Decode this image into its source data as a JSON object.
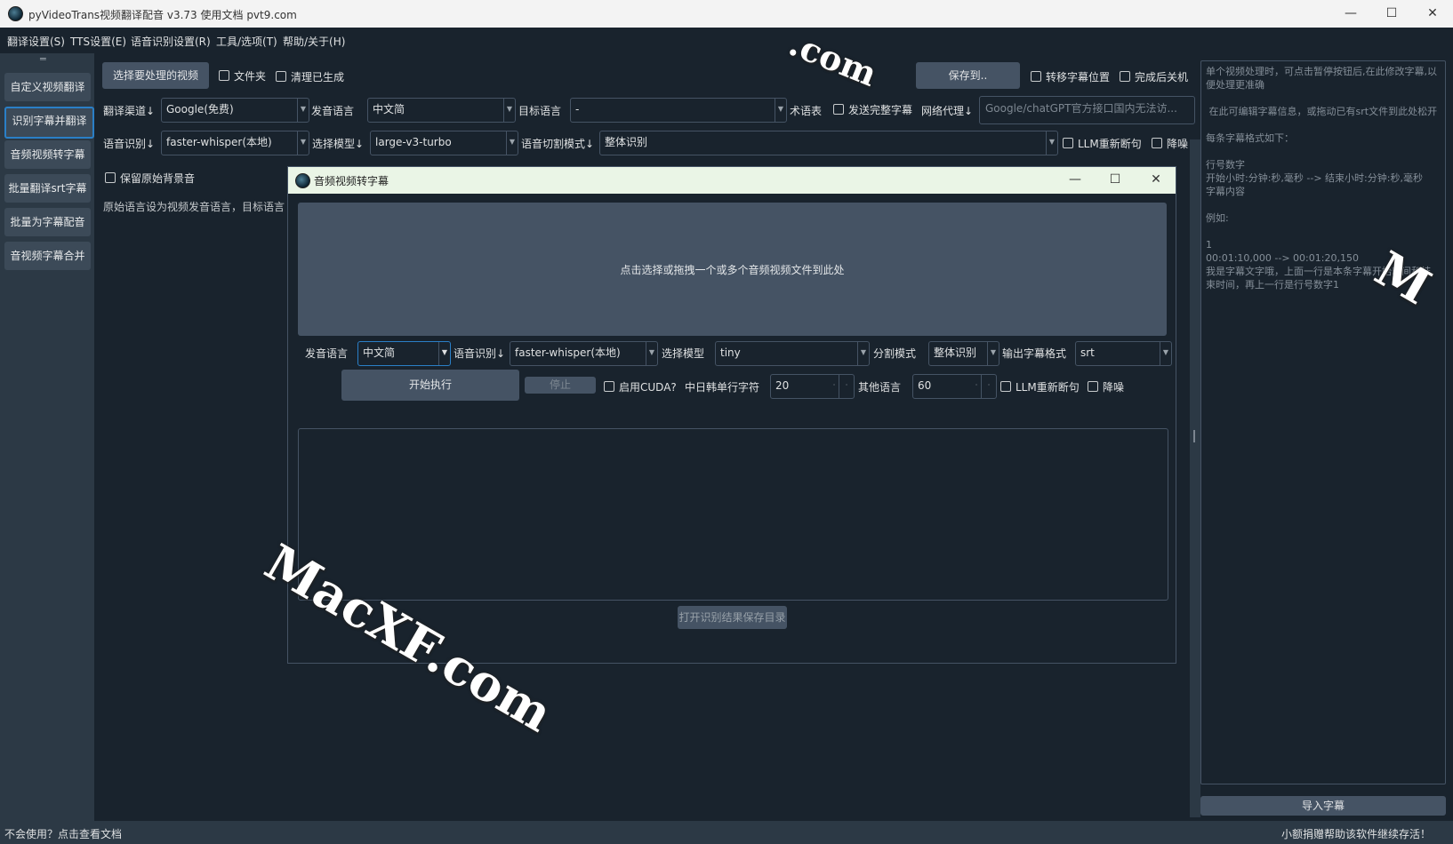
{
  "window": {
    "title": "pyVideoTrans视频翻译配音 v3.73  使用文档  pvt9.com",
    "minimize": "—",
    "maximize": "☐",
    "close": "✕"
  },
  "menu": [
    "翻译设置(S)",
    "TTS设置(E)",
    "语音识别设置(R)",
    "工具/选项(T)",
    "帮助/关于(H)"
  ],
  "sidebar": {
    "handle": "═",
    "items": [
      "自定义视频翻译",
      "识别字幕并翻译",
      "音频视频转字幕",
      "批量翻译srt字幕",
      "批量为字幕配音",
      "音视频字幕合并"
    ]
  },
  "toolbar": {
    "select_video": "选择要处理的视频",
    "folder": "文件夹",
    "clear_generated": "清理已生成",
    "save_to": "保存到..",
    "move_subtitle": "转移字幕位置",
    "shutdown": "完成后关机"
  },
  "row1": {
    "translate_channel_label": "翻译渠道↓",
    "translate_channel_value": "Google(免费)",
    "source_lang_label": "发音语言",
    "source_lang_value": "中文简",
    "target_lang_label": "目标语言",
    "target_lang_value": "-",
    "glossary": "术语表",
    "send_full_subtitle": "发送完整字幕",
    "proxy_label": "网络代理↓",
    "proxy_placeholder": "Google/chatGPT官方接口国内无法访..."
  },
  "row2": {
    "asr_label": "语音识别↓",
    "asr_value": "faster-whisper(本地)",
    "model_label": "选择模型↓",
    "model_value": "large-v3-turbo",
    "split_label": "语音切割模式↓",
    "split_value": "整体识别",
    "llm_resegment": "LLM重新断句",
    "denoise": "降噪"
  },
  "row3": {
    "keep_bg": "保留原始背景音",
    "hint": "原始语言设为视频发音语言，目标语言"
  },
  "dialog": {
    "title": "音频视频转字幕",
    "minimize": "—",
    "maximize": "☐",
    "close": "✕",
    "dropzone": "点击选择或拖拽一个或多个音频视频文件到此处",
    "lang_label": "发音语言",
    "lang_value": "中文简",
    "asr_label": "语音识别↓",
    "asr_value": "faster-whisper(本地)",
    "model_label": "选择模型",
    "model_value": "tiny",
    "split_label": "分割模式",
    "split_value": "整体识别",
    "format_label": "输出字幕格式",
    "format_value": "srt",
    "start": "开始执行",
    "stop": "停止",
    "cuda": "启用CUDA?",
    "cjk_chars_label": "中日韩单行字符",
    "cjk_chars_value": "20",
    "other_lang_label": "其他语言",
    "other_lang_value": "60",
    "llm_resegment": "LLM重新断句",
    "denoise": "降噪",
    "open_dir": "打开识别结果保存目录"
  },
  "right_panel": {
    "text": "单个视频处理时，可点击暂停按钮后,在此修改字幕,以便处理更准确\n\n 在此可编辑字幕信息，或拖动已有srt文件到此处松开\n\n每条字幕格式如下：\n\n行号数字\n开始小时:分钟:秒,毫秒 --> 结束小时:分钟:秒,毫秒\n字幕内容\n\n例如:\n\n1\n00:01:10,000 --> 00:01:20,150\n我是字幕文字哦，上面一行是本条字幕开始时间和结束时间，再上一行是行号数字1",
    "import": "导入字幕"
  },
  "status": {
    "help": "不会使用？点击查看文档",
    "donate": "小额捐赠帮助该软件继续存活！"
  },
  "watermark": {
    "text1": "MacXF.com",
    "text2": ".com",
    "text3": "M"
  }
}
